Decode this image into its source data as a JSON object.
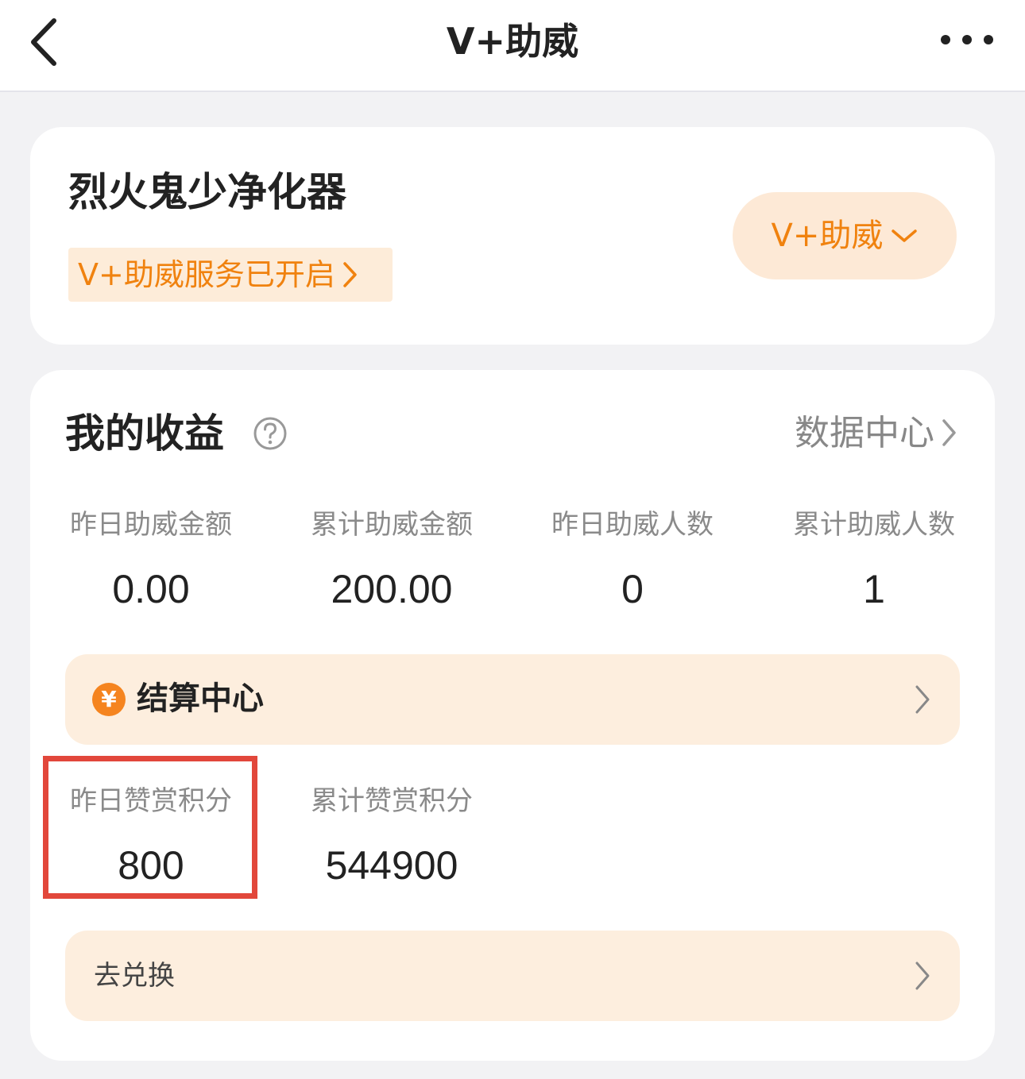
{
  "nav": {
    "title": "V+助威"
  },
  "product": {
    "name": "烈火鬼少净化器",
    "service_tag": "V+助威服务已开启",
    "pill_label": "V+助威"
  },
  "earnings": {
    "title": "我的收益",
    "data_center_label": "数据中心",
    "stats": [
      {
        "label": "昨日助威金额",
        "value": "0.00"
      },
      {
        "label": "累计助威金额",
        "value": "200.00"
      },
      {
        "label": "昨日助威人数",
        "value": "0"
      },
      {
        "label": "累计助威人数",
        "value": "1"
      }
    ],
    "settlement_label": "结算中心",
    "yen_symbol": "¥",
    "points": [
      {
        "label": "昨日赞赏积分",
        "value": "800"
      },
      {
        "label": "累计赞赏积分",
        "value": "544900"
      }
    ],
    "exchange_label": "去兑换"
  },
  "colors": {
    "accent": "#f0820f",
    "highlight": "#e2473b",
    "bar_bg": "#fdeede"
  }
}
